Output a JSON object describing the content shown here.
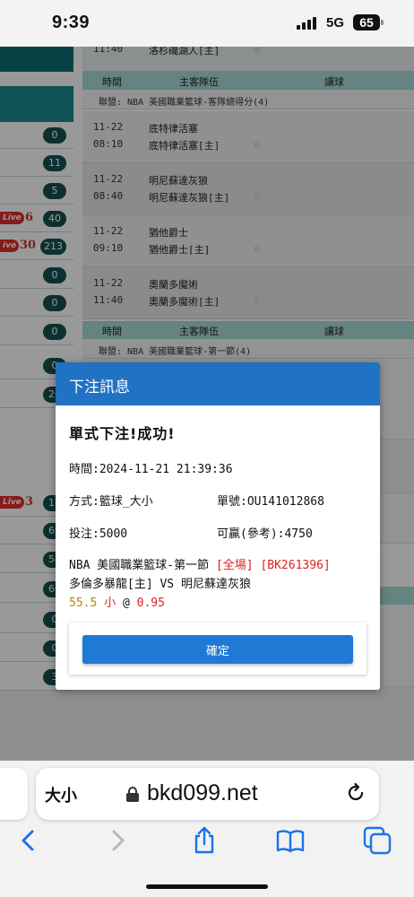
{
  "status_bar": {
    "time": "9:39",
    "network": "5G",
    "battery": "65"
  },
  "left_column": {
    "rows": [
      {
        "count": "0",
        "live": "",
        "live_num": ""
      },
      {
        "count": "11",
        "live": "",
        "live_num": ""
      },
      {
        "count": "5",
        "live": "",
        "live_num": ""
      },
      {
        "count": "40",
        "live": "Live",
        "live_num": "6"
      },
      {
        "count": "213",
        "live": "ive",
        "live_num": "30"
      },
      {
        "count": "0",
        "live": "",
        "live_num": ""
      },
      {
        "count": "0",
        "live": "",
        "live_num": ""
      },
      {
        "count": "0",
        "live": "",
        "live_num": ""
      },
      {
        "count": "0",
        "live": "",
        "live_num": ""
      },
      {
        "count": "20",
        "live": "",
        "live_num": ""
      }
    ],
    "rows2": [
      {
        "count": "18",
        "live": "Live",
        "live_num": "3"
      },
      {
        "count": "69",
        "live": "",
        "live_num": ""
      },
      {
        "count": "54",
        "live": "",
        "live_num": ""
      },
      {
        "count": "60",
        "live": "",
        "live_num": ""
      },
      {
        "count": "0",
        "live": "",
        "live_num": ""
      },
      {
        "count": "0",
        "live": "",
        "live_num": ""
      },
      {
        "count": "3",
        "live": "",
        "live_num": ""
      }
    ]
  },
  "main": {
    "top_game": {
      "time": "11:40",
      "team": "洛杉磯湖人[主]"
    },
    "header": {
      "time": "時間",
      "teams": "主客隊伍",
      "handicap": "讓球"
    },
    "league1": "聯盟: NBA 美國職業籃球-客隊總得分(4)",
    "games": [
      {
        "date": "11-22",
        "time": "08:10",
        "team1": "底特律活塞",
        "team2": "底特律活塞[主]"
      },
      {
        "date": "11-22",
        "time": "08:40",
        "team1": "明尼蘇達灰狼",
        "team2": "明尼蘇達灰狼[主]"
      },
      {
        "date": "11-22",
        "time": "09:10",
        "team1": "猶他爵士",
        "team2": "猶他爵士[主]"
      },
      {
        "date": "11-22",
        "time": "11:40",
        "team1": "奧蘭多魔術",
        "team2": "奧蘭多魔術[主]"
      }
    ],
    "league2": "聯盟: NBA 美國職業籃球-第一節(4)"
  },
  "dialog": {
    "title": "下注訊息",
    "heading": "單式下注!成功!",
    "time_label": "時間:",
    "time_value": "2024-11-21 21:39:36",
    "method_label": "方式:",
    "method_value": "籃球_大小",
    "ticket_label": "單號:",
    "ticket_value": "OU141012868",
    "stake_label": "投注:",
    "stake_value": "5000",
    "win_label": "可贏(參考):",
    "win_value": "4750",
    "league": "NBA 美國職業籃球-第一節",
    "scope": "[全場]",
    "code": "[BK261396]",
    "matchup": "多倫多暴龍[主] VS 明尼蘇達灰狼",
    "line": "55.5",
    "pick": "小",
    "at": "@",
    "odds": "0.95",
    "confirm_label": "確定"
  },
  "browser": {
    "text_size_label": "大小",
    "url": "bkd099.net"
  }
}
